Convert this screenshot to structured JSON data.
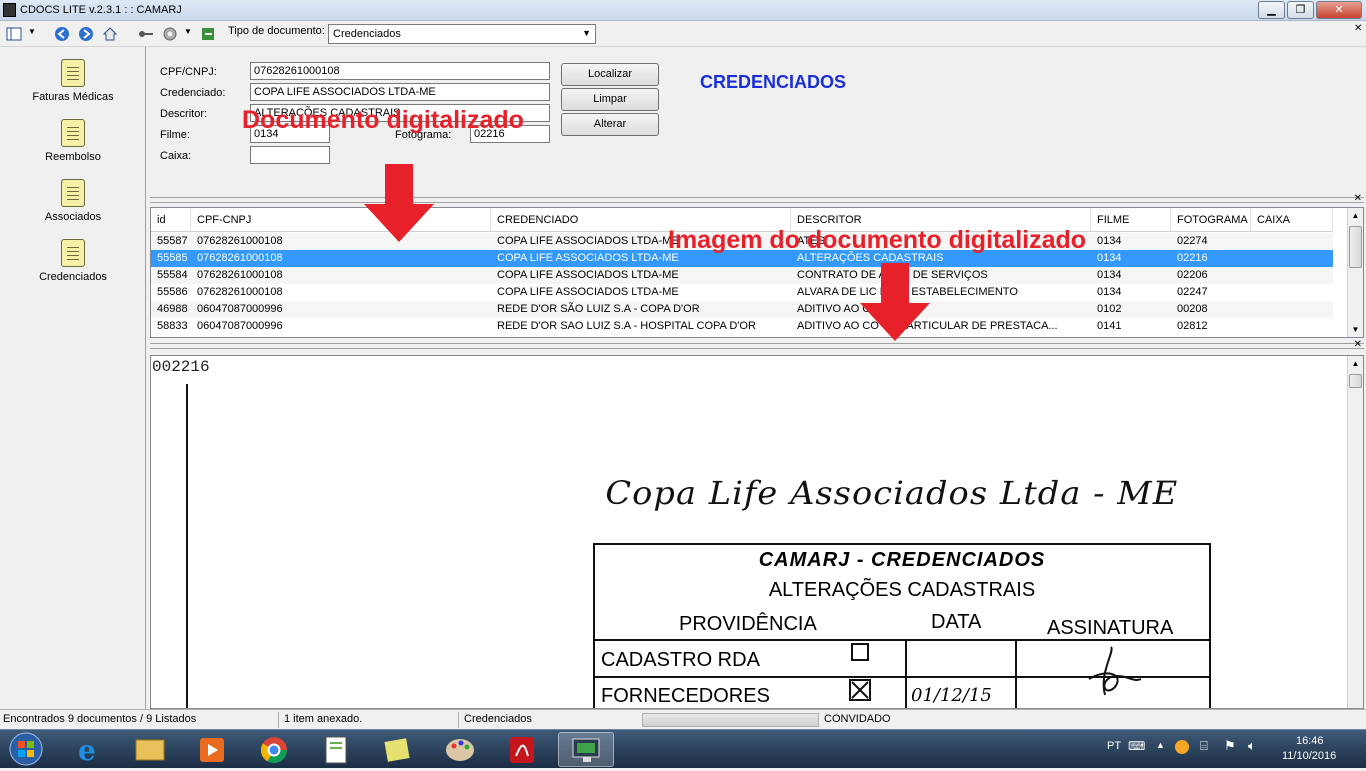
{
  "window": {
    "title": "CDOCS LITE v.2.3.1 : : CAMARJ",
    "minimize": "▁",
    "maximize": "❐",
    "close": "✕"
  },
  "toolbar": {
    "doc_type_label": "Tipo de documento:",
    "doc_type_value": "Credenciados",
    "icons": [
      "layout-icon",
      "back-icon",
      "forward-icon",
      "home-icon",
      "key-icon",
      "gear-icon",
      "exit-icon"
    ]
  },
  "sidebar": {
    "items": [
      {
        "label": "Faturas Médicas"
      },
      {
        "label": "Reembolso"
      },
      {
        "label": "Associados"
      },
      {
        "label": "Credenciados"
      }
    ]
  },
  "form": {
    "cpf_label": "CPF/CNPJ:",
    "cpf_value": "07628261000108",
    "credenciado_label": "Credenciado:",
    "credenciado_value": "COPA LIFE ASSOCIADOS LTDA-ME",
    "descritor_label": "Descritor:",
    "descritor_value": "ALTERAÇÕES CADASTRAIS",
    "filme_label": "Filme:",
    "filme_value": "0134",
    "fotograma_label": "Fotograma:",
    "fotograma_value": "02216",
    "caixa_label": "Caixa:",
    "caixa_value": "",
    "btn_localizar": "Localizar",
    "btn_limpar": "Limpar",
    "btn_alterar": "Alterar",
    "section_title": "CREDENCIADOS"
  },
  "grid": {
    "columns": [
      "id",
      "CPF-CNPJ",
      "CREDENCIADO",
      "DESCRITOR",
      "FILME",
      "FOTOGRAMA",
      "CAIXA"
    ],
    "rows": [
      [
        "55587",
        "07628261000108",
        "COPA LIFE ASSOCIADOS LTDA-ME",
        "ATES",
        "0134",
        "02274",
        ""
      ],
      [
        "55585",
        "07628261000108",
        "COPA LIFE ASSOCIADOS LTDA-ME",
        "ALTERAÇÕES CADASTRAIS",
        "0134",
        "02216",
        ""
      ],
      [
        "55584",
        "07628261000108",
        "COPA LIFE ASSOCIADOS LTDA-ME",
        "CONTRATO DE    AÇÃO DE SERVIÇOS",
        "0134",
        "02206",
        ""
      ],
      [
        "55586",
        "07628261000108",
        "COPA LIFE ASSOCIADOS LTDA-ME",
        "ALVARA DE LIC    PARA ESTABELECIMENTO",
        "0134",
        "02247",
        ""
      ],
      [
        "46988",
        "06047087000996",
        "REDE D'OR SÃO LUIZ S.A - COPA D'OR",
        "ADITIVO AO C",
        "0102",
        "00208",
        ""
      ],
      [
        "58833",
        "06047087000996",
        "REDE D'OR SAO LUIZ S.A - HOSPITAL COPA D'OR",
        "ADITIVO AO CO    TO PARTICULAR DE PRESTACA...",
        "0141",
        "02812",
        ""
      ]
    ],
    "selected_index": 1
  },
  "annotations": {
    "doc_label": "Documento digitalizado",
    "image_label": "Imagem do documento digitalizado"
  },
  "document": {
    "frame_number": "002216",
    "handwriting": "Copa Life Associados Ltda - ME",
    "stamp_title": "CAMARJ - CREDENCIADOS",
    "stamp_subtitle": "ALTERAÇÕES CADASTRAIS",
    "col_providencia": "PROVIDÊNCIA",
    "col_data": "DATA",
    "col_assinatura": "ASSINATURA",
    "row1": "CADASTRO RDA",
    "row2": "FORNECEDORES",
    "row2_date": "01/12/15"
  },
  "status": {
    "found": "Encontrados 9 documentos / 9 Listados",
    "attached": "1 item anexado.",
    "module": "Credenciados",
    "user": "CONVIDADO"
  },
  "tray": {
    "lang": "PT",
    "time": "16:46",
    "date": "11/10/2016"
  }
}
